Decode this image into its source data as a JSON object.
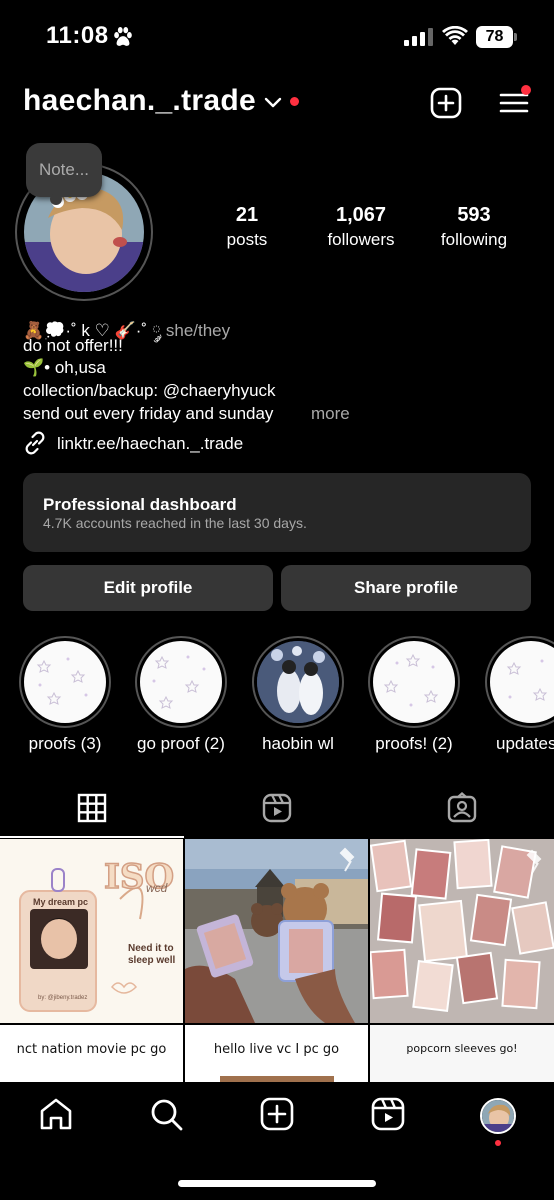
{
  "status_bar": {
    "time": "11:08",
    "battery": "78"
  },
  "header": {
    "username": "haechan._.trade"
  },
  "profile": {
    "note": "Note...",
    "stats": [
      {
        "num": "21",
        "label": "posts"
      },
      {
        "num": "1,067",
        "label": "followers"
      },
      {
        "num": "593",
        "label": "following"
      }
    ]
  },
  "bio": {
    "line1_emoji": "🧸💭·˚ k ♡ 🎸·˚ ༘",
    "pronouns": "she/they",
    "line2": "do not offer!!!",
    "line3": "🌱• oh,usa",
    "line4": "collection/backup: @chaeryhyuck",
    "line5": "send out every friday and sunday",
    "more": "more",
    "link": "linktr.ee/haechan._.trade"
  },
  "dashboard": {
    "title": "Professional dashboard",
    "subtitle": "4.7K accounts reached in the last 30 days."
  },
  "buttons": {
    "edit": "Edit profile",
    "share": "Share profile"
  },
  "highlights": [
    {
      "label": "proofs (3)"
    },
    {
      "label": "go proof (2)"
    },
    {
      "label": "haobin wl"
    },
    {
      "label": "proofs! (2)"
    },
    {
      "label": "updates"
    }
  ],
  "posts": {
    "tile1_title": "ISO",
    "tile1_sub": "wcd",
    "tile1_card_text": "My dream pc",
    "tile1_side_text": "Need it to sleep well",
    "tile1_credit": "by: @jibeny.tradez",
    "captions": [
      "nct nation movie pc go",
      "hello live vc I pc go",
      "popcorn sleeves go!"
    ]
  },
  "colors": {
    "notification_red": "#ff3040",
    "card_bg": "#262626",
    "button_bg": "#363636"
  }
}
